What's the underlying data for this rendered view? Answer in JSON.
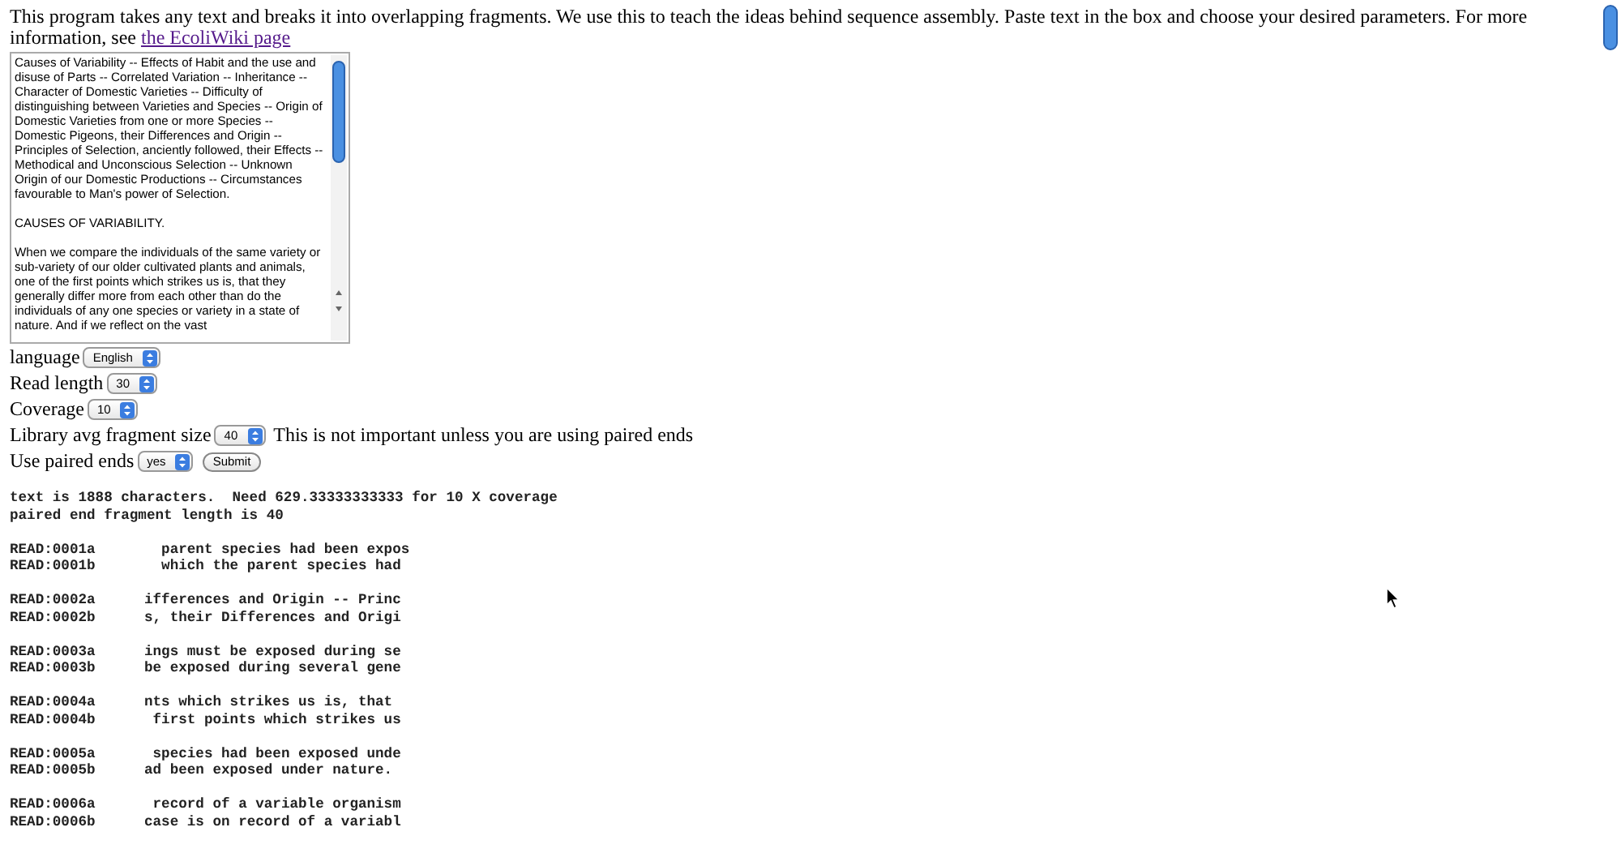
{
  "intro": {
    "text": "This program takes any text and breaks it into overlapping fragments. We use this to teach the ideas behind sequence assembly. Paste text in the box and choose your desired parameters. For more information, see ",
    "link": "the EcoliWiki page"
  },
  "text_box": {
    "paragraphs": [
      "Causes of Variability -- Effects of Habit and the use and disuse of Parts -- Correlated Variation -- Inheritance -- Character of Domestic Varieties -- Difficulty of distinguishing between Varieties and Species -- Origin of Domestic Varieties from one or more Species -- Domestic Pigeons, their Differences and Origin -- Principles of Selection, anciently followed, their Effects -- Methodical and Unconscious Selection -- Unknown Origin of our Domestic Productions -- Circumstances favourable to Man's power of Selection.",
      "CAUSES OF VARIABILITY.",
      "When we compare the individuals of the same variety or sub-variety of our older cultivated plants and animals, one of the first points which strikes us is, that they generally differ more from each other than do the individuals of any one species or variety in a state of nature. And if we reflect on the vast"
    ]
  },
  "fields": [
    {
      "label": "language",
      "value": "English"
    },
    {
      "label": "Read length",
      "value": "30"
    },
    {
      "label": "Coverage",
      "value": "10"
    },
    {
      "label": "Library avg fragment size",
      "value": "40",
      "note": "This is not important unless you are using paired ends"
    },
    {
      "label": "Use paired ends",
      "value": "yes"
    }
  ],
  "submit": "Submit",
  "output": {
    "summary": [
      "text is 1888 characters.  Need 629.33333333333 for 10 X coverage",
      "paired end fragment length is 40"
    ],
    "reads": [
      [
        {
          "id": "READ:0001a",
          "seq": "  parent species had been expos"
        },
        {
          "id": "READ:0001b",
          "seq": "  which the parent species had"
        }
      ],
      [
        {
          "id": "READ:0002a",
          "seq": "ifferences and Origin -- Princ"
        },
        {
          "id": "READ:0002b",
          "seq": "s, their Differences and Origi"
        }
      ],
      [
        {
          "id": "READ:0003a",
          "seq": "ings must be exposed during se"
        },
        {
          "id": "READ:0003b",
          "seq": "be exposed during several gene"
        }
      ],
      [
        {
          "id": "READ:0004a",
          "seq": "nts which strikes us is, that"
        },
        {
          "id": "READ:0004b",
          "seq": " first points which strikes us"
        }
      ],
      [
        {
          "id": "READ:0005a",
          "seq": " species had been exposed unde"
        },
        {
          "id": "READ:0005b",
          "seq": "ad been exposed under nature."
        }
      ],
      [
        {
          "id": "READ:0006a",
          "seq": " record of a variable organism"
        },
        {
          "id": "READ:0006b",
          "seq": "case is on record of a variabl"
        }
      ]
    ]
  }
}
